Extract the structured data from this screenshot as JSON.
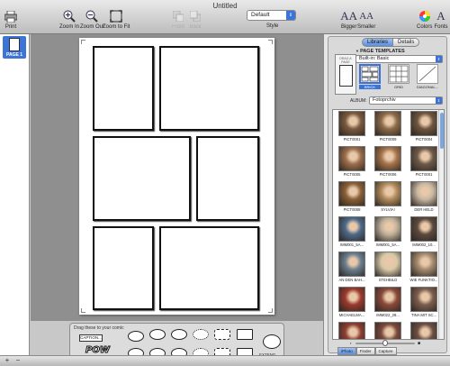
{
  "window": {
    "title": "Untitled"
  },
  "toolbar": {
    "print": "Print",
    "zoom_in": "Zoom In",
    "zoom_out": "Zoom Out",
    "zoom_fit": "Zoom to Fit",
    "front": "Front",
    "back": "Back",
    "style_value": "Default",
    "style_label": "Style",
    "bigger": "Bigger",
    "smaller": "Smaller",
    "colors": "Colors",
    "fonts": "Fonts",
    "bigger_glyph": "AA",
    "smaller_glyph": "AA"
  },
  "pages": {
    "items": [
      {
        "label": "PAGE 1"
      }
    ]
  },
  "bottom": {
    "add": "+",
    "remove": "−"
  },
  "palette": {
    "header": "Drag these to your comic",
    "caption": "CAPTION...",
    "pow": "POW",
    "extend": "EXTEND"
  },
  "drawer": {
    "tabs": [
      {
        "label": "Libraries"
      },
      {
        "label": "Details"
      }
    ],
    "section": "PAGE TEMPLATES",
    "template_set": "Built-in: Basic",
    "drag_hint": "DRAG A PAGE",
    "templates": [
      {
        "label": "BRICK"
      },
      {
        "label": "GRID"
      },
      {
        "label": "DIAGONAL..."
      }
    ],
    "album_label": "ALBUM:",
    "album_value": "Fotoprchiv",
    "photos": [
      {
        "label": "PICT0001",
        "color": "#7a5a3f"
      },
      {
        "label": "PICT0009",
        "color": "#8c6b4b"
      },
      {
        "label": "PICT0004",
        "color": "#6e5640"
      },
      {
        "label": "PICT0005",
        "color": "#9a6d4c"
      },
      {
        "label": "PICT0006",
        "color": "#a5744b"
      },
      {
        "label": "PICT0001",
        "color": "#6d5a49"
      },
      {
        "label": "PICT0008",
        "color": "#8a6038"
      },
      {
        "label": "SYLVIA!",
        "color": "#b08b5c"
      },
      {
        "label": "DER HELD",
        "color": "#c9b8a2"
      },
      {
        "label": "IMM001_5A...",
        "color": "#4d6a8a"
      },
      {
        "label": "IMM001_5A...",
        "color": "#c1b29c"
      },
      {
        "label": "IMM002_10...",
        "color": "#5c4a3e"
      },
      {
        "label": "AN DEN BAH...",
        "color": "#6b7f8f"
      },
      {
        "label": "STEHBILD",
        "color": "#d9c9a8"
      },
      {
        "label": "WIE FUNKTIO...",
        "color": "#a48a6e"
      },
      {
        "label": "MICHAELMA...",
        "color": "#9b3a2f"
      },
      {
        "label": "IMM022_28...",
        "color": "#8a4a3a"
      },
      {
        "label": "TINA MIT SC...",
        "color": "#7c5e4e"
      },
      {
        "label": "C+T AM TISCH",
        "color": "#8d3e32"
      },
      {
        "label": "C+T AM TISCH",
        "color": "#7a4a3c"
      },
      {
        "label": "C+T BEIM TA...",
        "color": "#6c4f43"
      }
    ],
    "sources": [
      {
        "label": "iPhoto"
      },
      {
        "label": "Finder"
      },
      {
        "label": "Capture"
      }
    ]
  }
}
